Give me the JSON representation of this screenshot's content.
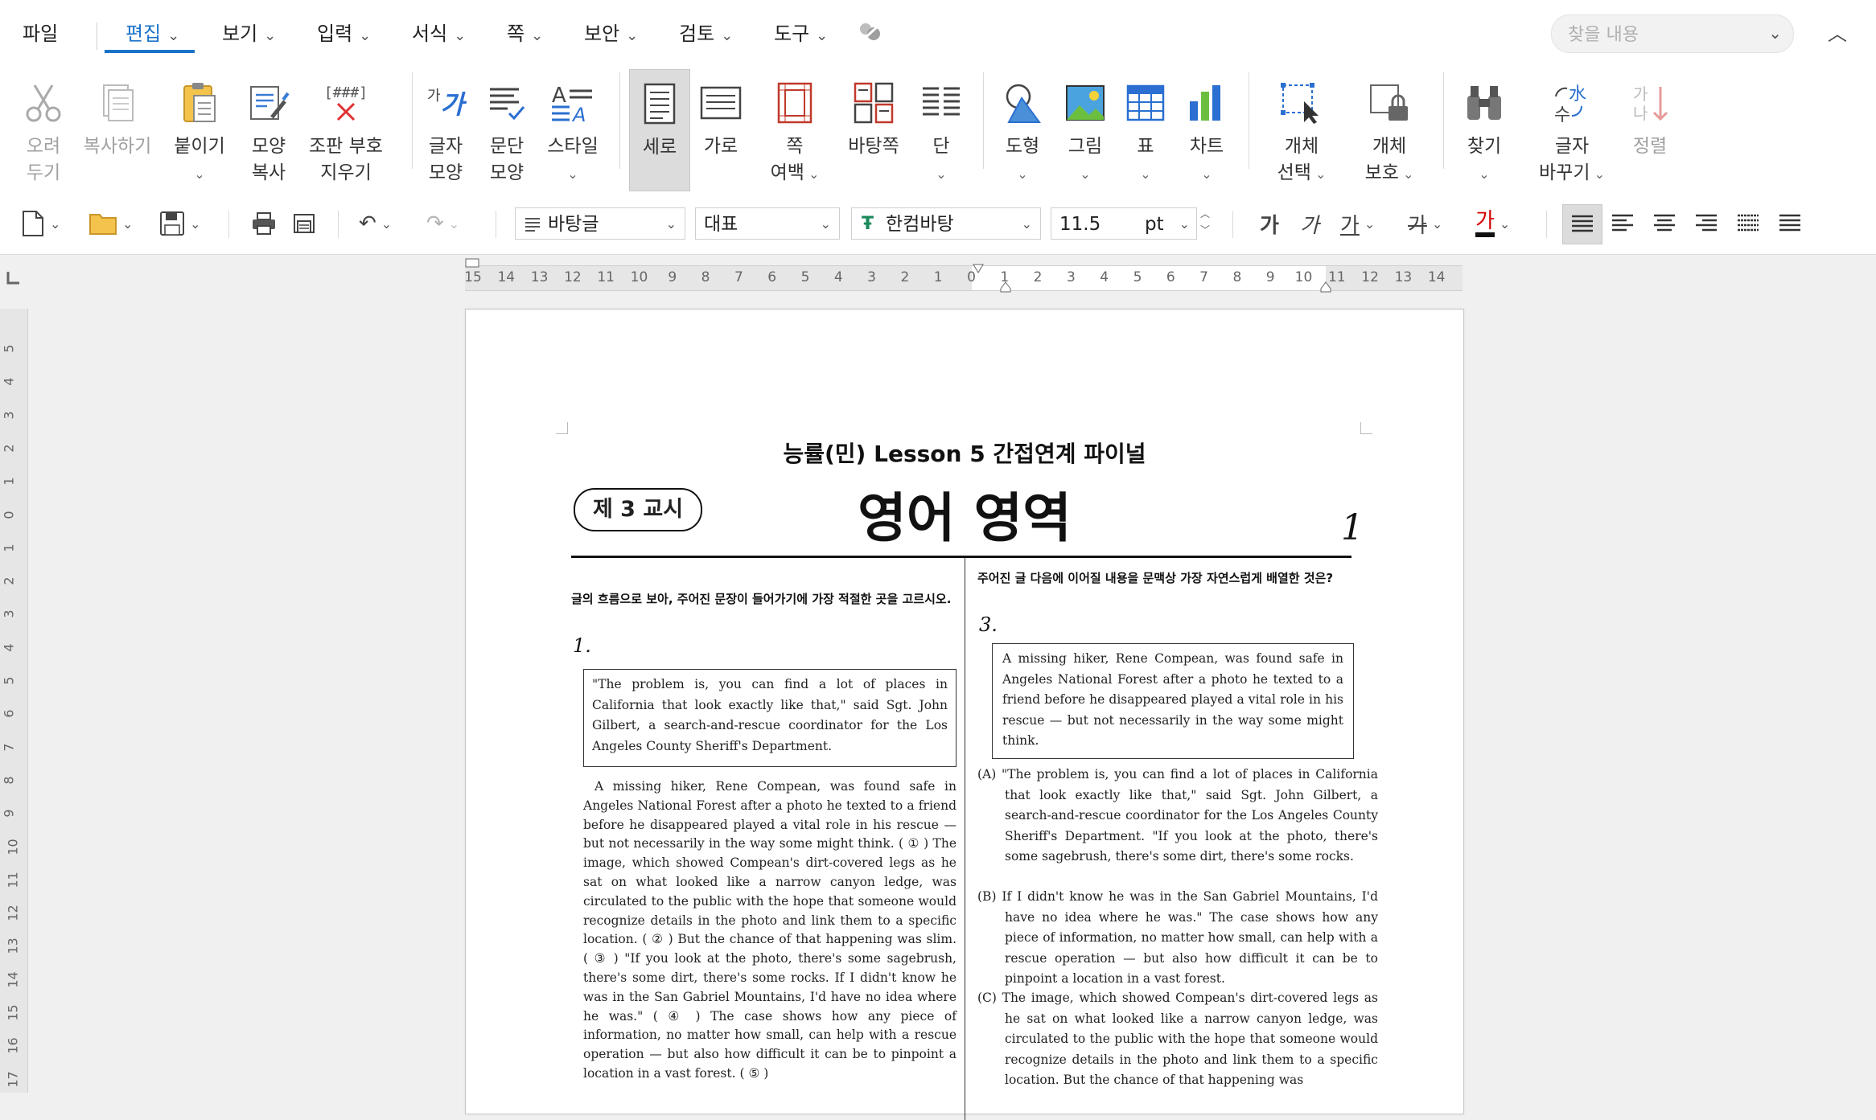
{
  "menu": {
    "file": "파일",
    "items": [
      {
        "label": "편집",
        "active": true
      },
      {
        "label": "보기"
      },
      {
        "label": "입력"
      },
      {
        "label": "서식"
      },
      {
        "label": "쪽"
      },
      {
        "label": "보안"
      },
      {
        "label": "검토"
      },
      {
        "label": "도구"
      }
    ],
    "search_placeholder": "찾을 내용"
  },
  "ribbon": {
    "cut": "오려\n두기",
    "copy": "복사하기",
    "paste": "붙이기",
    "format_copy": "모양\n복사",
    "clear_marks": "조판 부호\n지우기",
    "char_shape": "글자\n모양",
    "para_shape": "문단\n모양",
    "style": "스타일",
    "portrait": "세로",
    "landscape": "가로",
    "page_margin": "쪽\n여백",
    "master_page": "바탕쪽",
    "columns": "단",
    "shape": "도형",
    "picture": "그림",
    "table": "표",
    "chart": "차트",
    "select_object": "개체\n선택",
    "protect_object": "개체\n보호",
    "find": "찾기",
    "replace": "글자\n바꾸기",
    "sort": "정렬",
    "icon_text": {
      "clear_marks_top": "[###]",
      "char_shape_a": "가",
      "char_shape_b": "가",
      "style_a": "A"
    }
  },
  "format": {
    "style": "바탕글",
    "lang": "대표",
    "font": "한컴바탕",
    "size": "11.5",
    "unit": "pt",
    "bold": "가",
    "italic": "가",
    "underline": "가",
    "strike": "가",
    "color": "가",
    "font_color": "#d40000"
  },
  "ruler": {
    "h_numbers": [
      "15",
      "14",
      "13",
      "12",
      "11",
      "10",
      "9",
      "8",
      "7",
      "6",
      "5",
      "4",
      "3",
      "2",
      "1",
      "0",
      "1",
      "2",
      "3",
      "4",
      "5",
      "6",
      "7",
      "8",
      "9",
      "10",
      "11",
      "12",
      "13",
      "14"
    ],
    "v_numbers": [
      "5",
      "4",
      "3",
      "2",
      "1",
      "0",
      "1",
      "2",
      "3",
      "4",
      "5",
      "6",
      "7",
      "8",
      "9",
      "10",
      "11",
      "12",
      "13",
      "14",
      "15",
      "16",
      "17"
    ]
  },
  "page": {
    "exam_header": "능률(민) Lesson 5 간접연계 파이널",
    "period": "제 3 교시",
    "subject": "영어 영역",
    "page_number": "1",
    "left": {
      "instruction": "글의 흐름으로 보아, 주어진 문장이 들어가기에 가장 적절한 곳을 고르시오.",
      "q_number": "1.",
      "box_text": "\"The problem is, you can find a lot of places in California that look exactly like that,\" said Sgt. John Gilbert, a search-and-rescue coordinator for the Los Angeles County Sheriff's Department.",
      "passage": "A missing hiker, Rene Compean, was found safe in Angeles National Forest after a photo he texted to a friend before he disappeared played a vital role in his rescue — but not necessarily in the way some might think. ( ① ) The image, which showed Compean's dirt-covered legs as he sat on what looked like a narrow canyon ledge, was circulated to the public with the hope that someone would recognize details in the photo and link them to a specific location. ( ② ) But the chance of that happening was slim. ( ③ ) \"If you look at the photo, there's some sagebrush, there's some dirt, there's some rocks. If I didn't know he was in the San Gabriel Mountains, I'd have no idea where he was.\" ( ④ ) The case shows how any piece of information, no matter how small, can help with a rescue operation — but also how difficult it can be to pinpoint a location in a vast forest. ( ⑤ )"
    },
    "right": {
      "instruction": "주어진 글 다음에 이어질 내용을 문맥상 가장 자연스럽게 배열한 것은?",
      "q_number": "3.",
      "box_text": "A missing hiker, Rene Compean, was found safe in Angeles National Forest after a photo he texted to a friend before he disappeared played a vital role in his rescue — but not necessarily in the way some might think.",
      "options": [
        "(A) \"The problem is, you can find a lot of places in California that look exactly like that,\" said Sgt. John Gilbert, a search-and-rescue coordinator for the Los Angeles County Sheriff's Department. \"If you look at the photo, there's some sagebrush, there's some dirt, there's some rocks.",
        "(B) If I didn't know he was in the San Gabriel Mountains, I'd have no idea where he was.\" The case shows how any piece of information, no matter how small, can help with a rescue operation — but also how difficult it can be to pinpoint a location in a vast forest.",
        "(C) The image, which showed Compean's dirt-covered legs as he sat on what looked like a narrow canyon ledge, was circulated to the public with the hope that someone would recognize details in the photo and link them to a specific location. But the chance of that happening was"
      ]
    }
  }
}
